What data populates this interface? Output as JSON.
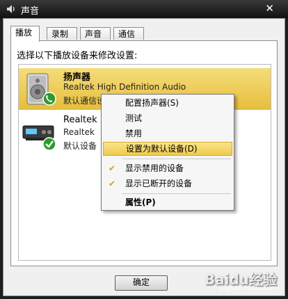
{
  "window": {
    "title": "声音",
    "close_glyph": "✕"
  },
  "tabs": [
    {
      "label": "播放",
      "active": true
    },
    {
      "label": "录制",
      "active": false
    },
    {
      "label": "声音",
      "active": false
    },
    {
      "label": "通信",
      "active": false
    }
  ],
  "instruction": "选择以下播放设备来修改设置:",
  "devices": [
    {
      "name": "扬声器",
      "description": "Realtek High Definition Audio",
      "status": "默认通信设备",
      "icon": "speaker-icon",
      "status_icon": "phone-check-icon",
      "selected": true
    },
    {
      "name": "Realtek",
      "description": "Realtek",
      "status": "默认设备",
      "icon": "digital-output-icon",
      "status_icon": "green-check-icon",
      "selected": false
    }
  ],
  "context_menu": {
    "items": [
      {
        "label": "配置扬声器(S)"
      },
      {
        "label": "测试"
      },
      {
        "label": "禁用"
      },
      {
        "label": "设置为默认设备(D)",
        "highlighted": true
      },
      {
        "label": "显示禁用的设备",
        "checked": true
      },
      {
        "label": "显示已断开的设备",
        "checked": true
      },
      {
        "label": "属性(P)",
        "bold": true
      }
    ],
    "check_glyph": "✔"
  },
  "buttons": {
    "ok": "确定"
  },
  "watermark": {
    "text": "Baidu经验",
    "url": "jingyan.baidu.com"
  },
  "colors": {
    "selection": "#e6bd3c",
    "check": "#d8a017"
  }
}
